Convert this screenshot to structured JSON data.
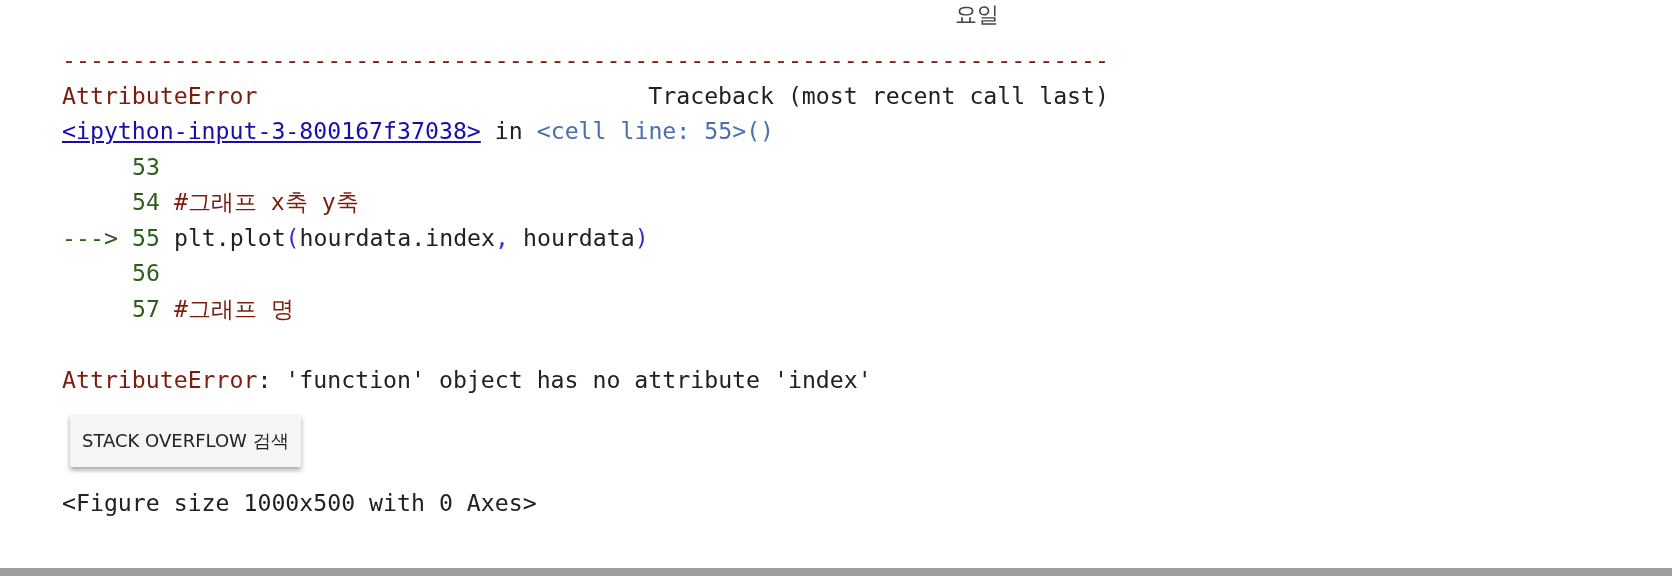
{
  "cut_heading": "요일",
  "traceback": {
    "separator": "---------------------------------------------------------------------------",
    "error_name": "AttributeError",
    "header": "Traceback (most recent call last)",
    "location": {
      "file_link": "<ipython-input-3-800167f37038>",
      "word": "in",
      "cell": "<cell line: 55>()"
    },
    "lines": [
      {
        "number": "53"
      },
      {
        "number": "54",
        "tokens": [
          {
            "kind": "comment",
            "text": "#그래프 x축 y축"
          }
        ]
      },
      {
        "number": "55",
        "arrow": "--->",
        "tokens": [
          {
            "kind": "code",
            "text": "plt.plot"
          },
          {
            "kind": "paren",
            "text": "("
          },
          {
            "kind": "code",
            "text": "hourdata.index"
          },
          {
            "kind": "punct",
            "text": ","
          },
          {
            "kind": "code",
            "text": " hourdata"
          },
          {
            "kind": "paren",
            "text": ")"
          }
        ]
      },
      {
        "number": "56"
      },
      {
        "number": "57",
        "tokens": [
          {
            "kind": "comment",
            "text": "#그래프 명"
          }
        ]
      }
    ],
    "error_type": "AttributeError",
    "error_message": ": 'function' object has no attribute 'index'"
  },
  "search_button": "STACK OVERFLOW 검색",
  "output": "<Figure size 1000x500 with 0 Axes>"
}
